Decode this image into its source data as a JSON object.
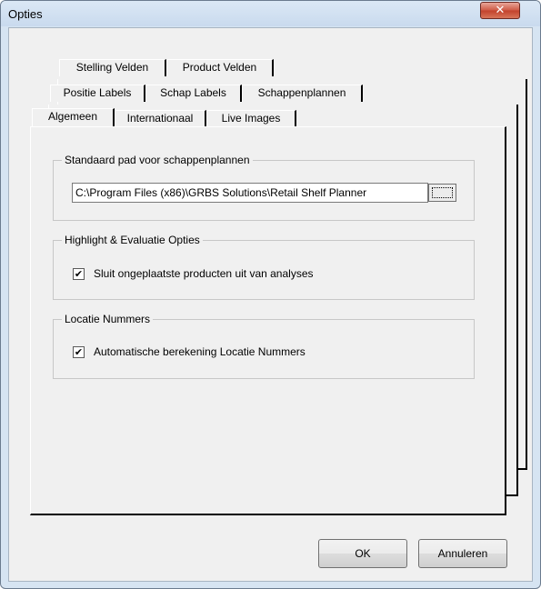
{
  "window": {
    "title": "Opties",
    "close_glyph": "✕"
  },
  "tabs": {
    "row1": [
      "Stelling Velden",
      "Product Velden"
    ],
    "row2": [
      "Positie Labels",
      "Schap Labels",
      "Schappenplannen"
    ],
    "row3": [
      "Algemeen",
      "Internationaal",
      "Live Images"
    ],
    "active": "Algemeen"
  },
  "groups": {
    "path": {
      "title": "Standaard pad voor schappenplannen",
      "value": "C:\\Program Files (x86)\\GRBS Solutions\\Retail Shelf Planner"
    },
    "highlight": {
      "title": "Highlight & Evaluatie Opties",
      "checkbox_label": "Sluit ongeplaatste producten uit van analyses",
      "checked": true
    },
    "location": {
      "title": "Locatie Nummers",
      "checkbox_label": "Automatische berekening Locatie Nummers",
      "checked": true
    }
  },
  "check_glyph": "✔",
  "buttons": {
    "ok": "OK",
    "cancel": "Annuleren"
  }
}
